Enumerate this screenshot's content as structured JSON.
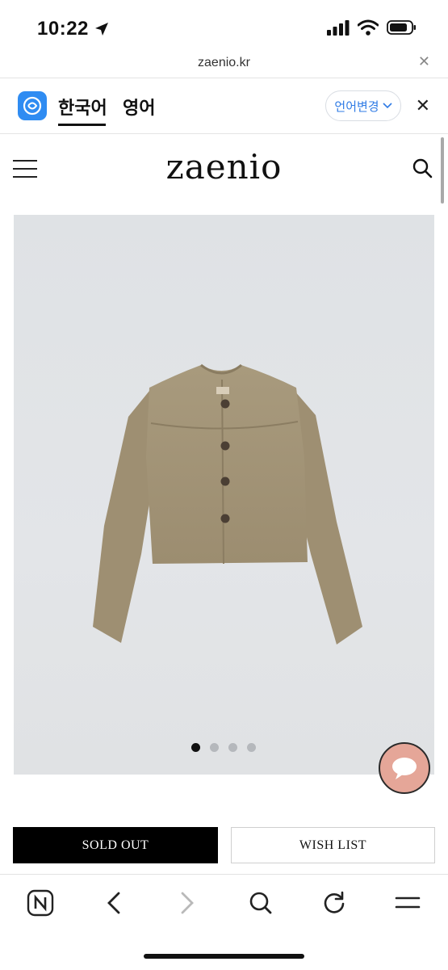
{
  "status_bar": {
    "time": "10:22",
    "icons": [
      "location-arrow-icon",
      "signal-icon",
      "wifi-icon",
      "battery-icon"
    ]
  },
  "browser": {
    "url": "zaenio.kr"
  },
  "translate_bar": {
    "source_language": "한국어",
    "target_language": "영어",
    "change_language_label": "언어변경"
  },
  "site": {
    "brand": "zaenio"
  },
  "product": {
    "image_subject": "beige suede collarless cropped jacket",
    "carousel_total": 4,
    "carousel_active_index": 0
  },
  "actions": {
    "sold_out_label": "SOLD OUT",
    "wish_list_label": "WISH LIST"
  },
  "colors": {
    "accent_blue": "#2f8cf2",
    "chat_button": "#e5a698",
    "sold_out_bg": "#000000"
  }
}
